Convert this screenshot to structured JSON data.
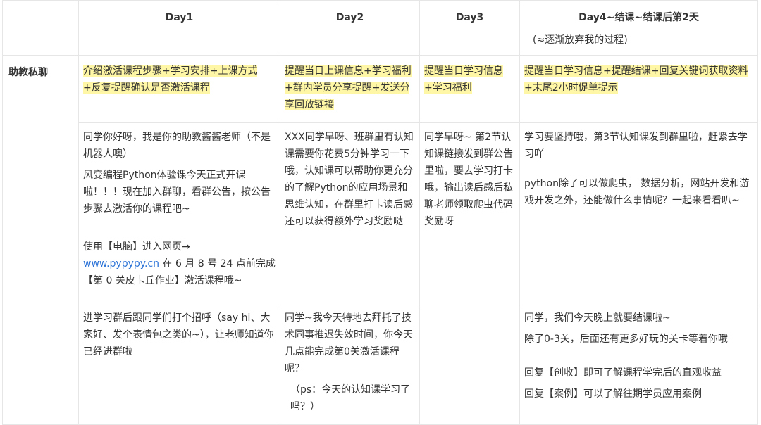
{
  "header": {
    "day1": "Day1",
    "day2": "Day2",
    "day3": "Day3",
    "day4": "Day4~结课~结课后第2天",
    "day4_sub": "(≈逐渐放弃我的过程)"
  },
  "row_label": "助教私聊",
  "summary": {
    "day1": "介绍激活课程步骤+学习安排+上课方式+反复提醒确认是否激活课程",
    "day2": "提醒当日上课信息+学习福利+群内学员分享提醒+发送分享回放链接",
    "day3": "提醒当日学习信息+学习福利",
    "day4": "提醒当日学习信息+提醒结课+回复关键词获取资料+末尾2小时促单提示"
  },
  "row1": {
    "day1_p1": "同学你好呀，我是你的助教酱酱老师（不是机器人噢）",
    "day1_p2": "风变编程Python体验课今天正式开课啦！！！现在加入群聊，看群公告，按公告步骤去激活你的课程吧~",
    "day1_p3_a": "使用【电脑】进入网页→",
    "day1_link": "www.pypypy.cn",
    "day1_p3_b": " 在 6 月 8 号 24 点前完成【第 0 关皮卡丘作业】激活课程哦~",
    "day2": "XXX同学早呀、班群里有认知课需要你花费5分钟学习一下哦，认知课可以帮助你更充分的了解Python的应用场景和思维认知，在群里打卡读后感还可以获得额外学习奖励哒",
    "day3": "同学早呀~ 第2节认知课链接发到群公告里啦，要去学习打卡哦，输出读后感后私聊老师领取爬虫代码奖励呀",
    "day4_p1": "学习要坚持哦，第3节认知课发到群里啦，赶紧去学习吖",
    "day4_p2": "python除了可以做爬虫， 数据分析，网站开发和游戏开发之外，还能做什么事情呢？一起来看看叭~"
  },
  "row2": {
    "day1": "进学习群后跟同学们打个招呼（say hi、大家好、发个表情包之类的~），让老师知道你已经进群啦",
    "day2_p1": "同学~我今天特地去拜托了技术同事推迟失效时间，你今天几点能完成第0关激活课程呢？",
    "day2_p2": "（ps：今天的认知课学习了吗？）",
    "day4_p1": "同学，我们今天晚上就要结课啦~",
    "day4_p2": "除了0-3关，后面还有更多好玩的关卡等着你哦",
    "day4_p3": "回复【创收】即可了解课程学完后的直观收益",
    "day4_p4": "回复【案例】可以了解往期学员应用案例"
  }
}
